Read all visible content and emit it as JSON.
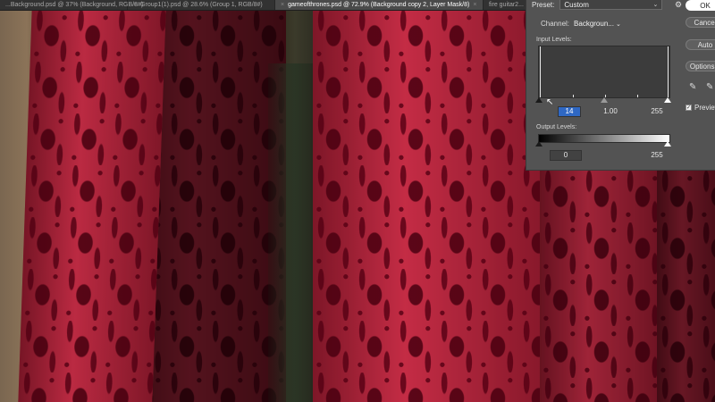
{
  "tabs": [
    {
      "label": "...Background.psd @ 37% (Background, RGB/8#)",
      "active": false
    },
    {
      "label": "Group1(1).psd @ 28.6% (Group 1, RGB/8#)",
      "active": false
    },
    {
      "label": "gameofthrones.psd @ 72.9% (Background copy 2, Layer Mask/8)",
      "active": true
    },
    {
      "label": "fire guitar2...",
      "active": false
    }
  ],
  "levels": {
    "preset_label": "Preset:",
    "preset_value": "Custom",
    "channel_label": "Channel:",
    "channel_value": "Backgroun...",
    "input_levels_label": "Input Levels:",
    "input_black": "14",
    "input_gamma": "1.00",
    "input_white": "255",
    "output_levels_label": "Output Levels:",
    "output_black": "0",
    "output_white": "255",
    "ok_label": "OK",
    "cancel_label": "Cancel",
    "auto_label": "Auto",
    "options_label": "Options...",
    "preview_label": "Preview",
    "preview_checked": true
  },
  "icons": {
    "close": "close-icon",
    "chevron": "chevron-down-icon",
    "gear": "gear-icon",
    "eyedropper": "eyedropper-icon",
    "cursor": "cursor-icon"
  }
}
